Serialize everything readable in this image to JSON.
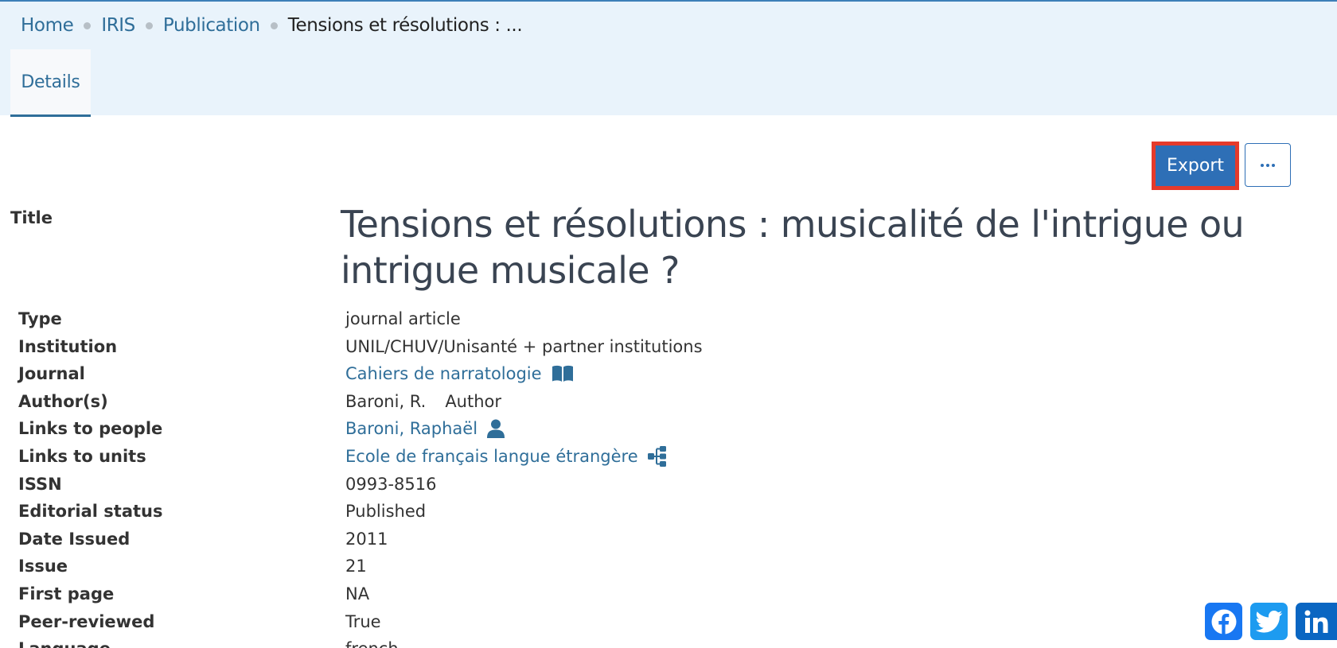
{
  "breadcrumb": {
    "home": "Home",
    "iris": "IRIS",
    "publication": "Publication",
    "current": "Tensions et résolutions : ..."
  },
  "tabs": {
    "details": "Details"
  },
  "toolbar": {
    "export_label": "Export",
    "more_icon": "ellipsis-icon"
  },
  "title": {
    "label": "Title",
    "value": "Tensions et résolutions : musicalité de l'intrigue ou intrigue musicale ?"
  },
  "fields": {
    "type": {
      "label": "Type",
      "value": "journal article"
    },
    "institution": {
      "label": "Institution",
      "value": "UNIL/CHUV/Unisanté + partner institutions"
    },
    "journal": {
      "label": "Journal",
      "value": "Cahiers de narratologie",
      "icon": "book-icon"
    },
    "authors": {
      "label": "Author(s)",
      "value": "Baroni, R.",
      "role": "Author"
    },
    "people": {
      "label": "Links to people",
      "value": "Baroni, Raphaël",
      "icon": "person-icon"
    },
    "units": {
      "label": "Links to units",
      "value": "Ecole de français langue étrangère",
      "icon": "sitemap-icon"
    },
    "issn": {
      "label": "ISSN",
      "value": "0993-8516"
    },
    "editorial_status": {
      "label": "Editorial status",
      "value": "Published"
    },
    "date_issued": {
      "label": "Date Issued",
      "value": "2011"
    },
    "issue": {
      "label": "Issue",
      "value": "21"
    },
    "first_page": {
      "label": "First page",
      "value": "NA"
    },
    "peer_reviewed": {
      "label": "Peer-reviewed",
      "value": "True"
    },
    "language": {
      "label": "Language",
      "value": "french"
    }
  },
  "share": {
    "facebook": "facebook-icon",
    "twitter": "twitter-icon",
    "linkedin": "linkedin-icon"
  },
  "colors": {
    "accent": "#2e6fb6",
    "link": "#2f6e99",
    "band": "#e9f3fb",
    "highlight": "#e53a2b"
  }
}
